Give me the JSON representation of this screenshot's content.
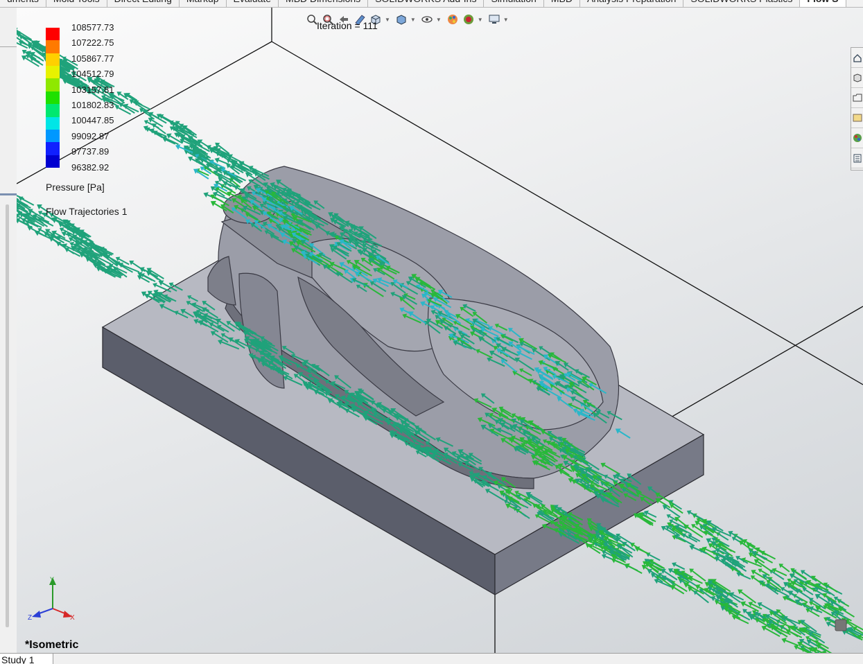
{
  "ribbon": {
    "tabs": [
      {
        "label": "uments",
        "active": false
      },
      {
        "label": "Mold Tools",
        "active": false
      },
      {
        "label": "Direct Editing",
        "active": false
      },
      {
        "label": "Markup",
        "active": false
      },
      {
        "label": "Evaluate",
        "active": false
      },
      {
        "label": "MBD Dimensions",
        "active": false
      },
      {
        "label": "SOLIDWORKS Add-Ins",
        "active": false
      },
      {
        "label": "Simulation",
        "active": false
      },
      {
        "label": "MBD",
        "active": false
      },
      {
        "label": "Analysis Preparation",
        "active": false
      },
      {
        "label": "SOLIDWORKS Plastics",
        "active": false
      },
      {
        "label": "Flow S",
        "active": true
      }
    ]
  },
  "viewport": {
    "iteration_text": "Iteration = 111",
    "view_name": "*Isometric",
    "triad_labels": {
      "x": "X",
      "y": "Y",
      "z": "Z"
    }
  },
  "legend": {
    "title": "Pressure [Pa]",
    "values": [
      "108577.73",
      "107222.75",
      "105867.77",
      "104512.79",
      "103157.81",
      "101802.83",
      "100447.85",
      "99092.87",
      "97737.89",
      "96382.92"
    ],
    "colors": [
      "#ff0000",
      "#ff7a00",
      "#ffd000",
      "#e8f200",
      "#8fe800",
      "#1fe000",
      "#00e870",
      "#00e6e6",
      "#0098ff",
      "#1020ff",
      "#0000d0"
    ]
  },
  "plot_label": "Flow Trajectories 1",
  "heads_up_toolbar": {
    "icons": [
      "zoom-to-fit-icon",
      "zoom-area-icon",
      "previous-view-icon",
      "section-view-icon",
      "view-orientation-icon",
      "display-style-icon",
      "hide-show-icon",
      "edit-appearance-icon",
      "apply-scene-icon",
      "view-settings-icon"
    ]
  },
  "right_taskpane": {
    "buttons": [
      "home-icon",
      "parts-library-icon",
      "file-explorer-icon",
      "view-palette-icon",
      "appearances-icon",
      "custom-properties-icon"
    ]
  },
  "bottom_tabs": [
    {
      "label": "Study 1"
    }
  ],
  "colors": {
    "trajectory_main": "#1fa27a",
    "trajectory_fast": "#28b83a",
    "trajectory_slow": "#2ab7c9",
    "model_gray": "#8c8e98"
  }
}
